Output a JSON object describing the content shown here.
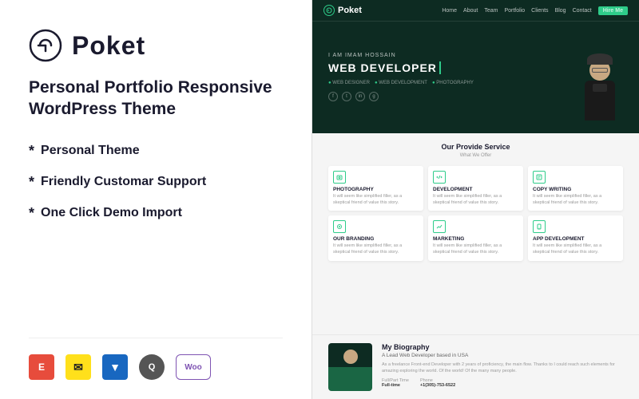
{
  "left": {
    "logo": {
      "text": "Poket",
      "icon_label": "poket-logo-icon"
    },
    "tagline": "Personal Portfolio Responsive WordPress Theme",
    "features": [
      "Personal Theme",
      "Friendly Customar Support",
      "One Click Demo Import"
    ],
    "plugins": [
      {
        "id": "elementor",
        "label": "E",
        "title": "Elementor"
      },
      {
        "id": "mailchimp",
        "label": "✉",
        "title": "Mailchimp"
      },
      {
        "id": "vuetify",
        "label": "▼",
        "title": "Vuetify"
      },
      {
        "id": "q",
        "label": "Q",
        "title": "Q"
      },
      {
        "id": "woo",
        "label": "Woo",
        "title": "WooCommerce"
      }
    ]
  },
  "right": {
    "nav": {
      "logo": "Poket",
      "links": [
        "Home",
        "About",
        "Team",
        "Portfolio",
        "Clients",
        "Blog",
        "Contact"
      ],
      "cta": "Hire Me"
    },
    "hero": {
      "sub_text": "I AM IMAM HOSSAIN",
      "title": "WEB DEVELOPER",
      "tags": [
        "WEB DESIGNER",
        "WEB DEVELOPMENT",
        "PHOTOGRAPHY"
      ],
      "social": [
        "f",
        "t",
        "in",
        "g"
      ]
    },
    "services": {
      "title": "Our Provide Service",
      "subtitle": "What We Offer",
      "items": [
        {
          "icon": "📷",
          "name": "PHOTOGRAPHY",
          "desc": "It will seem like simplified filler, as a skeptical friend of value this story."
        },
        {
          "icon": "💻",
          "name": "DEVELOPMENT",
          "desc": "It will seem like simplified filler, as a skeptical friend of value this story."
        },
        {
          "icon": "✏️",
          "name": "COPY WRITING",
          "desc": "It will seem like simplified filler, as a skeptical friend of value this story."
        },
        {
          "icon": "🎨",
          "name": "OUR BRANDING",
          "desc": "It will seem like simplified filler, as a skeptical friend of value this story."
        },
        {
          "icon": "📊",
          "name": "MARKETING",
          "desc": "It will seem like simplified filler, as a skeptical friend of value this story."
        },
        {
          "icon": "📱",
          "name": "APP DEVELOPMENT",
          "desc": "It will seem like simplified filler, as a skeptical friend of value this story."
        }
      ]
    },
    "biography": {
      "title": "My Biography",
      "subtitle": "A Lead Web Developer based in USA",
      "body": "As a freelance Front-end Developer with 2 years of proficiency, the main flow. Thanks to I could reach such elements for amazing exploring the world. Of the world! Of the many many people.",
      "details": [
        {
          "label": "Full/Part Time",
          "value": "Full-time"
        },
        {
          "label": "Phone",
          "value": "+1(305)-753-6522"
        }
      ]
    }
  }
}
